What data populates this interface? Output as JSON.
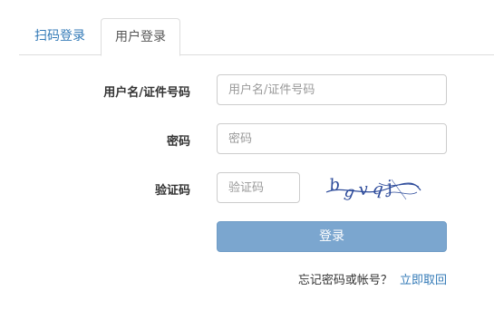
{
  "tabs": [
    {
      "label": "扫码登录",
      "active": false
    },
    {
      "label": "用户登录",
      "active": true
    }
  ],
  "form": {
    "username_label": "用户名/证件号码",
    "username_placeholder": "用户名/证件号码",
    "password_label": "密码",
    "password_placeholder": "密码",
    "captcha_label": "验证码",
    "captcha_placeholder": "验证码",
    "captcha_image_text": "bgvqj",
    "login_button": "登录"
  },
  "footer": {
    "forgot_text": "忘记密码或帐号？",
    "recover_link": "立即取回"
  },
  "colors": {
    "link": "#337ab7",
    "button": "#7ba6cf",
    "border": "#cccccc",
    "captcha_ink": "#2c4a9a"
  }
}
